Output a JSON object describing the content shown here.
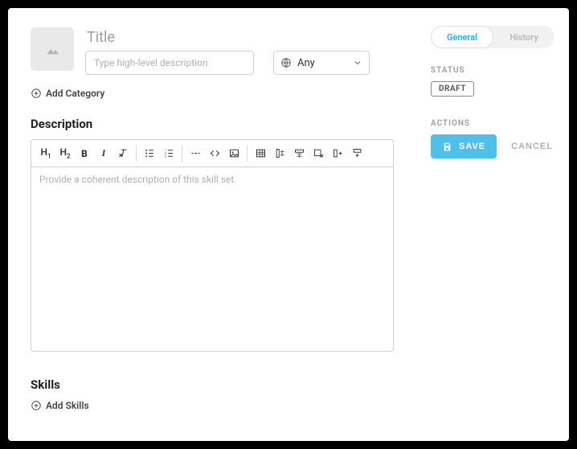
{
  "header": {
    "title_placeholder": "Title",
    "description_placeholder": "Type high-level description",
    "scope_selected": "Any"
  },
  "links": {
    "add_category": "Add Category",
    "add_skills": "Add Skills"
  },
  "sections": {
    "description": "Description",
    "skills": "Skills"
  },
  "editor": {
    "placeholder": "Provide a coherent description of this skill set"
  },
  "sidebar": {
    "tabs": {
      "general": "General",
      "history": "History"
    },
    "status_label": "STATUS",
    "status_value": "DRAFT",
    "actions_label": "ACTIONS",
    "save": "SAVE",
    "cancel": "CANCEL"
  }
}
